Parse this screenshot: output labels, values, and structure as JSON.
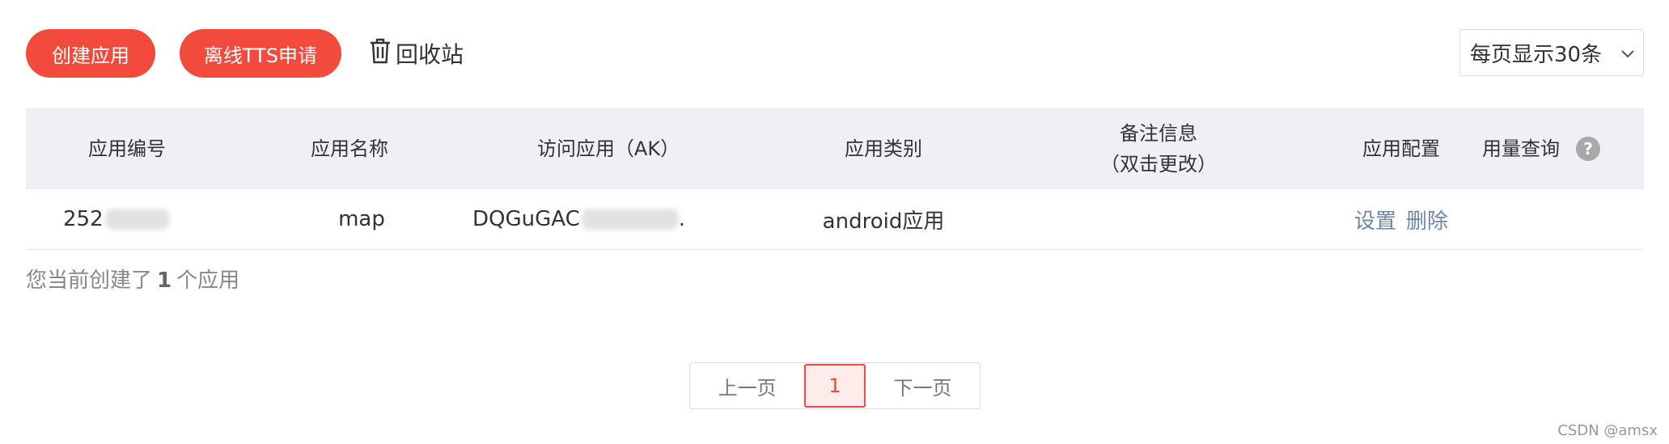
{
  "toolbar": {
    "create_label": "创建应用",
    "tts_label": "离线TTS申请",
    "recycle_label": "回收站",
    "per_page_label": "每页显示30条"
  },
  "table": {
    "headers": {
      "app_id": "应用编号",
      "app_name": "应用名称",
      "access_ak": "访问应用（AK）",
      "app_type": "应用类别",
      "remark_line1": "备注信息",
      "remark_line2": "（双击更改）",
      "config": "应用配置",
      "usage": "用量查询"
    },
    "rows": [
      {
        "app_id": "252",
        "app_name": "map",
        "access_ak": "DQGuGAC",
        "access_ak_tail": ".",
        "app_type": "android应用",
        "remark": "",
        "config_set": "设置",
        "config_delete": "删除"
      }
    ]
  },
  "summary": {
    "prefix": "您当前创建了",
    "count": "1",
    "suffix": "个应用"
  },
  "pagination": {
    "prev_label": "上一页",
    "current_page": "1",
    "next_label": "下一页"
  },
  "watermark": "CSDN @amsx",
  "colors": {
    "primary": "#f24a3c",
    "header_bg": "#eef0f5",
    "link": "#6d87a8"
  },
  "icons": {
    "recycle": "trash-icon",
    "dropdown": "chevron-down-icon",
    "help": "help-icon"
  }
}
